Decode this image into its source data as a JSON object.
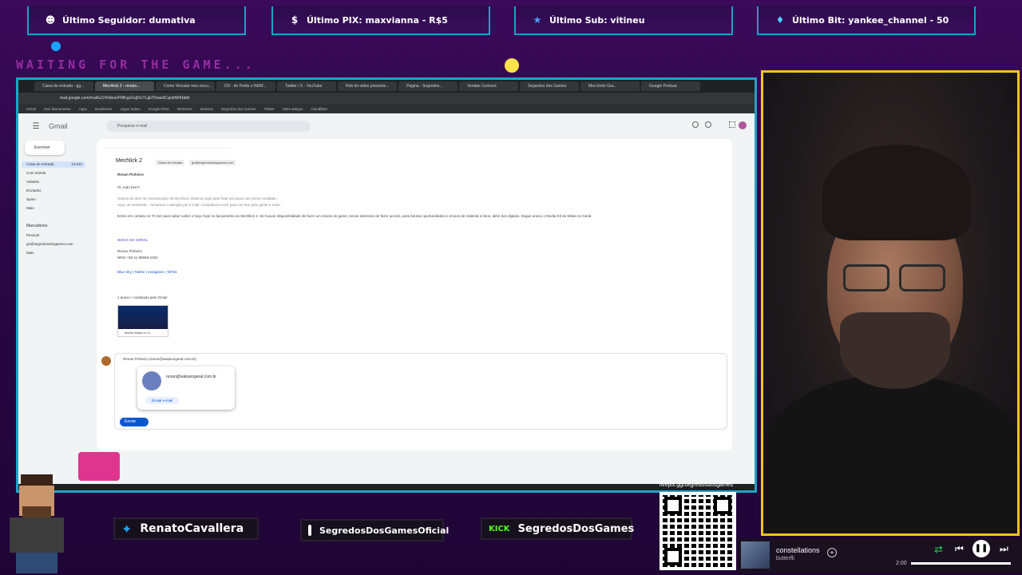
{
  "alerts": {
    "follower": "Último Seguidor: dumativa",
    "pix": "Último PIX: maxvianna - R$5",
    "sub": "Último Sub: vitineu",
    "bit": "Último Bit: yankee_channel - 50"
  },
  "waiting_text": "WAITING FOR THE GAME...",
  "browser": {
    "url": "mail.google.com/mail/u/1/#inbox/FMfcgzGqDrsTLgbTfxswdCsjnkfWKbbtb",
    "tabs": [
      "Caixa de entrada - gg...",
      "Mechlick 2 - renato...",
      "Como Vincular meu escu...",
      "OX - de Pediu o NEW...",
      "Twitter / X - YouTube",
      "Rob do video presente...",
      "Pagina - Segredos...",
      "Vendas Connect",
      "Segredos dos Games",
      "Meu lindo Gra...",
      "Google Pontuar"
    ],
    "bookmarks": [
      "Gmail",
      "meu faturamento",
      "Apps",
      "Brasileirao",
      "Jogos Indies",
      "Google Drive",
      "Diretrizes",
      "Noticias",
      "Segredos dos Games",
      "Twitter",
      "Sites antigos",
      "Cloudflare"
    ]
  },
  "gmail": {
    "logo": "Gmail",
    "search_placeholder": "Pesquisar e-mail",
    "compose_label": "Escrever",
    "nav": [
      "Caixa de entrada",
      "Com estrela",
      "Adiados",
      "Enviados",
      "Spam",
      "Mais"
    ],
    "inbox_count": "12.912",
    "labels_header": "Marcadores",
    "labels": [
      "Pessoal",
      "gn@segredosdosgames.com",
      "Mais"
    ],
    "subject": "Mechlick 2",
    "subject_tags": [
      "Caixa de entrada",
      "gn@segredosdosgames.com"
    ],
    "sender": "Renan Pinheiro",
    "greeting": "Oi, tudo bem?",
    "body_lines": [
      "Somos do time de comunicação da Mechlick, estamos aqui para falar um pouco da nossa novidade...",
      "Aqui, um lembrete... tomamos o atenção por e-mail, convidamos você para um tour pelo game e mais...",
      "Entrei em contato no TA Ser para saber sobre o traço hoje no lançamento do Mechlick 2. Se houver disponibilidade de fazer um review do game, temos interesse de fazer acordo, para futuras oportunidades e envios de material a fotos, além dos digitais. Segue anexo o Media Kit do Waka no Geral."
    ],
    "signature_brand": "WAKA NO GERAL",
    "signature_name": "Renan Pinheiro",
    "signature_phone": "NEW +55 11 98666-2322",
    "signature_links": "Blue Sky | Twitter | Instagram | TikTok",
    "attachment_header": "1 anexo • Analisado pelo Gmail",
    "attachment_name": "Media Waka no G...",
    "reply_to": "Renan Pinheiro (renan@wakanogeral.com.br)",
    "popup_email": "renan@wakanogeral.com.br",
    "popup_action": "Enviar e-mail",
    "send_label": "Enviar"
  },
  "socials": {
    "twitter": "RenatoCavallera",
    "instagram": "SegredosDosGamesOficial",
    "kick_badge": "KICK",
    "kick": "SegredosDosGames"
  },
  "qr_label": "livepix.gg/segredosdosgames",
  "player": {
    "title": "constellations",
    "artist": "butterfli",
    "time": "2:00",
    "progress": 0.92
  },
  "colors": {
    "border_cyan": "#1fa4c8",
    "cam_border": "#f0c419",
    "waiting": "#b53ab8"
  }
}
